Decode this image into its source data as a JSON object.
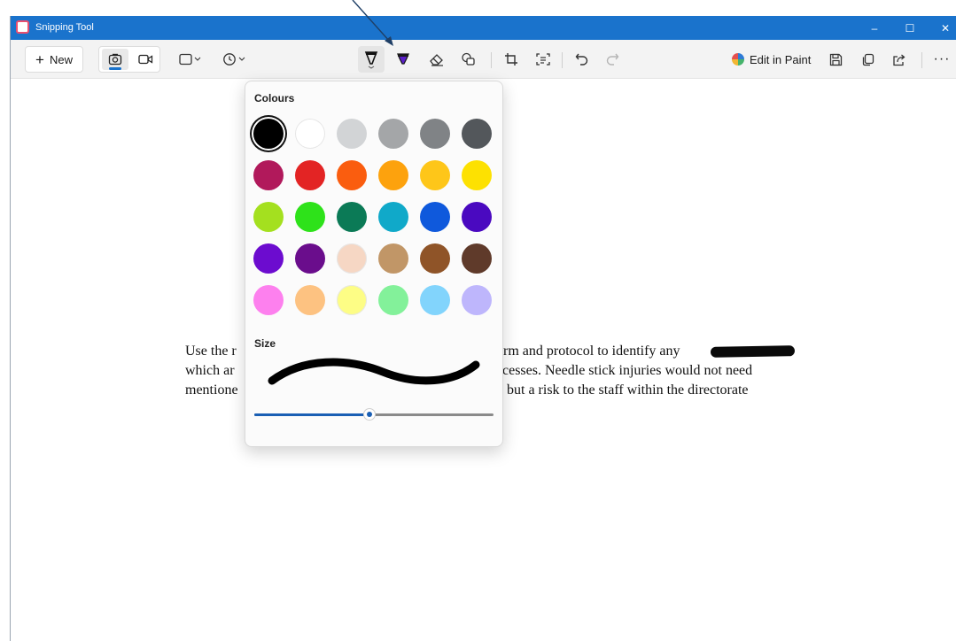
{
  "window": {
    "title": "Snipping Tool",
    "controls": {
      "minimize": "–",
      "maximize": "☐",
      "close": "✕"
    }
  },
  "toolbar": {
    "new_label": "New",
    "new_icon": "plus-icon",
    "mode": {
      "selected": "screenshot",
      "options": [
        "screenshot",
        "video"
      ]
    },
    "snip_shape_icon": "rectangle-snip-icon",
    "delay_icon": "timer-icon",
    "tools": [
      "ballpoint-pen-icon",
      "highlighter-icon",
      "eraser-icon",
      "shapes-icon",
      "crop-icon",
      "text-actions-icon",
      "undo-icon",
      "redo-icon"
    ],
    "active_tool": "ballpoint-pen-icon",
    "paint_label": "Edit in Paint",
    "right_icons": [
      "save-icon",
      "copy-icon",
      "share-icon",
      "more-icon"
    ]
  },
  "pen_popup": {
    "colours_label": "Colours",
    "size_label": "Size",
    "colours": [
      [
        "#000000",
        "#ffffff",
        "#d2d4d6",
        "#a4a6a8",
        "#808386",
        "#53575b"
      ],
      [
        "#b1195b",
        "#e32424",
        "#fa5d0f",
        "#fda20d",
        "#fec619",
        "#fde101"
      ],
      [
        "#a4e01f",
        "#2ee21a",
        "#0b7a56",
        "#10a9c9",
        "#0f59dc",
        "#4a09c0"
      ],
      [
        "#6c0ccf",
        "#6a0d8c",
        "#f6d7c4",
        "#c19667",
        "#8f5428",
        "#5f3a2a"
      ],
      [
        "#fd80ee",
        "#fdc281",
        "#fdfd85",
        "#83f19a",
        "#82d4fc",
        "#beb6fc"
      ]
    ],
    "selected_colour": "#000000",
    "size_fraction": 0.48
  },
  "document": {
    "line1_left": "Use the r",
    "line1_right": "rm and protocol to identify any",
    "line2_left": "which ar",
    "line2_right": "cesses.  Needle stick injuries would not need",
    "line3_left": "mentione",
    "line3_right": "but a risk to the staff within the directorate"
  }
}
